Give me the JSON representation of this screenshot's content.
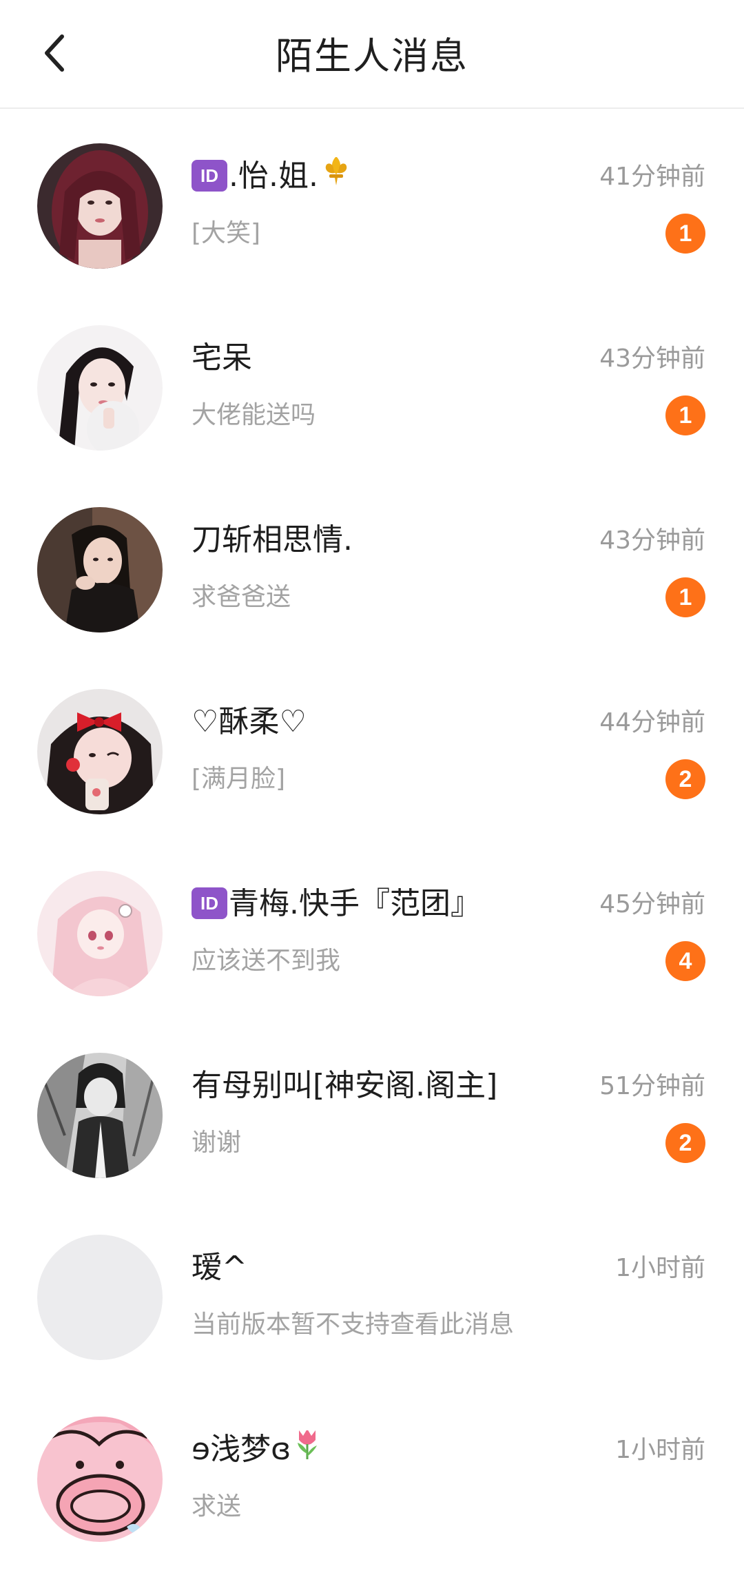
{
  "header": {
    "title": "陌生人消息",
    "back_icon": "chevron-left-icon"
  },
  "colors": {
    "badge": "#fe7118",
    "id_tag": "#8e54c9",
    "time_text": "#9a9a9a",
    "preview_text": "#a3a3a3"
  },
  "conversations": [
    {
      "id_tag": "ID",
      "name": ".怡.姐.",
      "name_deco": "fleur-de-lis-emoji",
      "time": "41分钟前",
      "preview": "[大笑]",
      "unread": "1"
    },
    {
      "id_tag": "",
      "name": "宅呆",
      "name_deco": "",
      "time": "43分钟前",
      "preview": "大佬能送吗",
      "unread": "1"
    },
    {
      "id_tag": "",
      "name": "刀斩相思情.",
      "name_deco": "",
      "time": "43分钟前",
      "preview": "求爸爸送",
      "unread": "1"
    },
    {
      "id_tag": "",
      "name": "♡酥柔♡",
      "name_deco": "",
      "time": "44分钟前",
      "preview": "[满月脸]",
      "unread": "2"
    },
    {
      "id_tag": "ID",
      "name": "青梅.快手『范团』",
      "name_deco": "",
      "time": "45分钟前",
      "preview": "应该送不到我",
      "unread": "4"
    },
    {
      "id_tag": "",
      "name": "有母别叫[神安阁.阁主]",
      "name_deco": "",
      "time": "51分钟前",
      "preview": "谢谢",
      "unread": "2"
    },
    {
      "id_tag": "",
      "name": "瑷^",
      "name_deco": "",
      "time": "1小时前",
      "preview": "当前版本暂不支持查看此消息",
      "unread": ""
    },
    {
      "id_tag": "",
      "name": "ɘ浅梦ɞ",
      "name_deco": "tulip-emoji",
      "time": "1小时前",
      "preview": "求送",
      "unread": ""
    }
  ]
}
